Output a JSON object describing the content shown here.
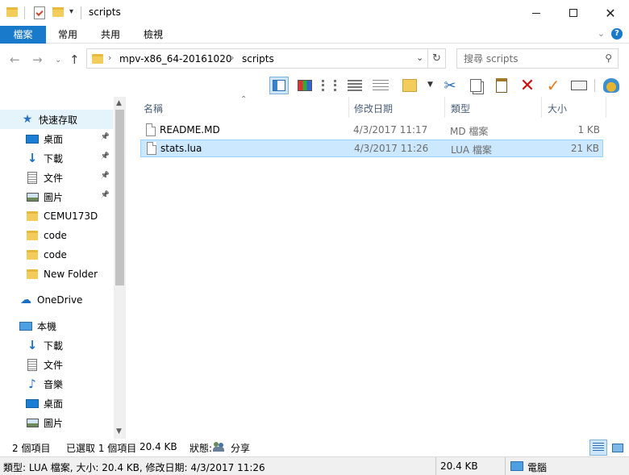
{
  "window": {
    "title": "scripts",
    "controls": [
      "minimize",
      "maximize",
      "close"
    ]
  },
  "ribbon": {
    "tabs": [
      "檔案",
      "常用",
      "共用",
      "檢視"
    ]
  },
  "address": {
    "segments": [
      "mpv-x86_64-20161020",
      "scripts"
    ]
  },
  "search": {
    "placeholder": "搜尋 scripts"
  },
  "nav": {
    "quick_access": "快速存取",
    "quick_items": [
      {
        "label": "桌面",
        "icon": "desktop-icon",
        "pinned": true
      },
      {
        "label": "下載",
        "icon": "download-icon",
        "pinned": true
      },
      {
        "label": "文件",
        "icon": "document-icon",
        "pinned": true
      },
      {
        "label": "圖片",
        "icon": "pictures-icon",
        "pinned": true
      },
      {
        "label": "CEMU173D",
        "icon": "folder-icon",
        "pinned": false
      },
      {
        "label": "code",
        "icon": "folder-icon",
        "pinned": false
      },
      {
        "label": "code",
        "icon": "folder-icon",
        "pinned": false
      },
      {
        "label": "New Folder",
        "icon": "folder-icon",
        "pinned": false
      }
    ],
    "onedrive": "OneDrive",
    "this_pc": "本機",
    "pc_items": [
      {
        "label": "下載",
        "icon": "download-icon"
      },
      {
        "label": "文件",
        "icon": "document-icon"
      },
      {
        "label": "音樂",
        "icon": "music-icon"
      },
      {
        "label": "桌面",
        "icon": "desktop-icon"
      },
      {
        "label": "圖片",
        "icon": "pictures-icon"
      }
    ]
  },
  "columns": {
    "name": "名稱",
    "modified": "修改日期",
    "type": "類型",
    "size": "大小"
  },
  "files": [
    {
      "name": "README.MD",
      "modified": "4/3/2017 11:17",
      "type": "MD 檔案",
      "size": "1 KB",
      "selected": false
    },
    {
      "name": "stats.lua",
      "modified": "4/3/2017 11:26",
      "type": "LUA 檔案",
      "size": "21 KB",
      "selected": true
    }
  ],
  "status": {
    "count": "2 個項目",
    "selected": "已選取 1 個項目",
    "selected_size": "20.4 KB",
    "state_label": "狀態:",
    "share": "分享"
  },
  "details": {
    "info": "類型: LUA 檔案, 大小: 20.4 KB, 修改日期: 4/3/2017 11:26",
    "size": "20.4 KB",
    "location": "電腦"
  },
  "colors": {
    "accent": "#1979ca",
    "selection_bg": "#cce8ff",
    "selection_border": "#99d1ff",
    "header_text": "#4c607a"
  }
}
